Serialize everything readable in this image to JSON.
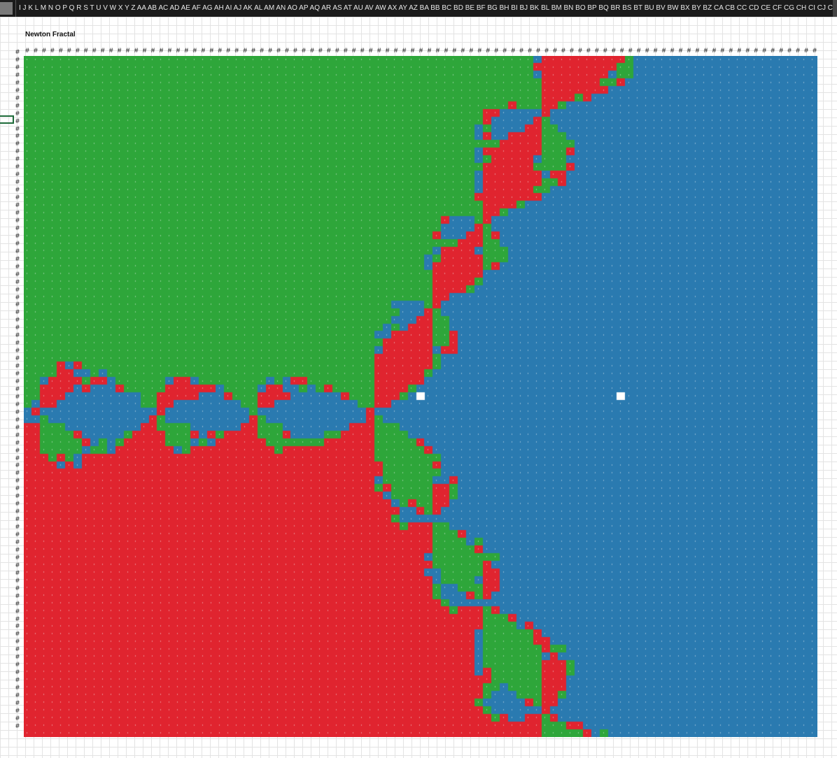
{
  "sheet": {
    "title": "Newton Fractal",
    "column_letters": "I J K L M N O P Q R S T U V W X Y Z AA AB AC AD AE AF AG AH AI AJ AK AL AM AN AO AP AQ AR AS AT AU AV AW AX AY AZ BA BB BC BD BE BF BG BH BI BJ BK BL BM BN BO BP BQ BR BS BT BU BV BW BX BY BZ CA CB CC CD CE CF CG CH CI CJ CK CL",
    "overflow_marker": "#"
  },
  "fractal": {
    "colors": {
      "root1": "#2a7ab0",
      "root2": "#e0242f",
      "root3": "#2ea63a",
      "blank": "#ffffff"
    },
    "cell_label_color": "#ffffff"
  }
}
